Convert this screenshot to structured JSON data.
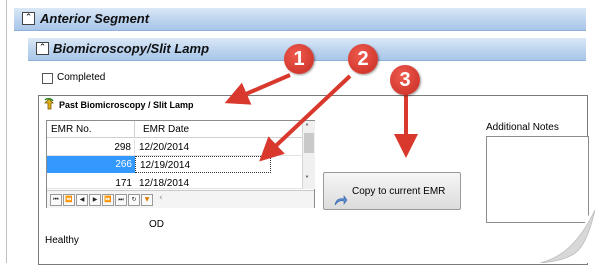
{
  "sections": {
    "anterior": {
      "title": "Anterior Segment",
      "toggle_icon": "collapse-up-icon"
    },
    "biomicroscopy": {
      "title": "Biomicroscopy/Slit Lamp",
      "toggle_icon": "collapse-up-icon"
    }
  },
  "completed": {
    "label": "Completed",
    "checked": false
  },
  "past_panel": {
    "title": "Past Biomicroscopy / Slit Lamp",
    "icon": "back-arrow-icon",
    "columns": [
      "EMR No.",
      "EMR Date"
    ],
    "rows": [
      {
        "emr_no": "298",
        "emr_date": "12/20/2014",
        "selected": false
      },
      {
        "emr_no": "266",
        "emr_date": "12/19/2014",
        "selected": true
      },
      {
        "emr_no": "171",
        "emr_date": "12/18/2014",
        "selected": false
      }
    ]
  },
  "copy_button": {
    "label": "Copy to current EMR",
    "icon": "curved-arrow-icon"
  },
  "additional_notes": {
    "label": "Additional Notes"
  },
  "od_label": "OD",
  "healthy_label": "Healthy",
  "callouts": [
    "1",
    "2",
    "3"
  ],
  "colors": {
    "header_blue": "#b9d2ee",
    "selected_row": "#3399ff",
    "callout_red": "#d9382d"
  }
}
